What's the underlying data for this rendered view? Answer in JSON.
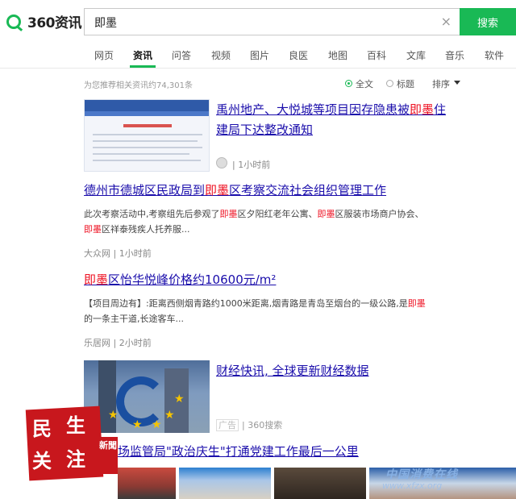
{
  "header": {
    "logo_text": "360资讯",
    "search_value": "即墨",
    "clear_symbol": "×",
    "search_button": "搜索"
  },
  "tabs": [
    {
      "label": "网页",
      "active": false
    },
    {
      "label": "资讯",
      "active": true
    },
    {
      "label": "问答",
      "active": false
    },
    {
      "label": "视频",
      "active": false
    },
    {
      "label": "图片",
      "active": false
    },
    {
      "label": "良医",
      "active": false
    },
    {
      "label": "地图",
      "active": false
    },
    {
      "label": "百科",
      "active": false
    },
    {
      "label": "文库",
      "active": false
    },
    {
      "label": "音乐",
      "active": false
    },
    {
      "label": "软件",
      "active": false
    }
  ],
  "filter": {
    "count_text": "为您推荐相关资讯约74,301条",
    "opt_fulltext": "全文",
    "opt_title": "标题",
    "sort": "排序"
  },
  "results": [
    {
      "title_pre": "禹州地产、大悦城等项目因存隐患被",
      "title_kw": "即墨",
      "title_post": "住",
      "title_line2": "建局下达整改通知",
      "meta": "| 1小时前"
    },
    {
      "title_pre": "德州市德城区民政局到",
      "title_kw": "即墨",
      "title_post": "区考察交流社会组织管理工作",
      "snippet_1a": "此次考察活动中,考察组先后参观了",
      "snippet_1kw": "即墨",
      "snippet_1b": "区夕阳红老年公寓、",
      "snippet_1kw2": "即墨",
      "snippet_1c": "区服装市场商户协会、",
      "snippet_2kw": "即墨",
      "snippet_2b": "区祥泰残疾人托养服...",
      "meta": "大众网 | 1小时前"
    },
    {
      "title_kw": "即墨",
      "title_post": "区怡华悦峰价格约10600元/m²",
      "snippet_1a": "【项目周边有】:距离西侧烟青路约1000米距离,烟青路是青岛至烟台的一级公路,是",
      "snippet_1kw": "即墨",
      "snippet_2": "的一条主干道,长途客车...",
      "meta": "乐居网 | 2小时前"
    },
    {
      "title": "财经快讯, 全球更新财经数据",
      "ad_label": "广告",
      "ad_source": "| 360搜索"
    },
    {
      "title": "场监管局\"政治庆生\"打通党建工作最后一公里"
    }
  ],
  "stamp": {
    "c1": "民",
    "c2": "生",
    "c3": "关",
    "c4": "注",
    "side": "新聞"
  },
  "watermark": {
    "line1": "中国消费在线",
    "line2": "www.xfzx.org"
  }
}
